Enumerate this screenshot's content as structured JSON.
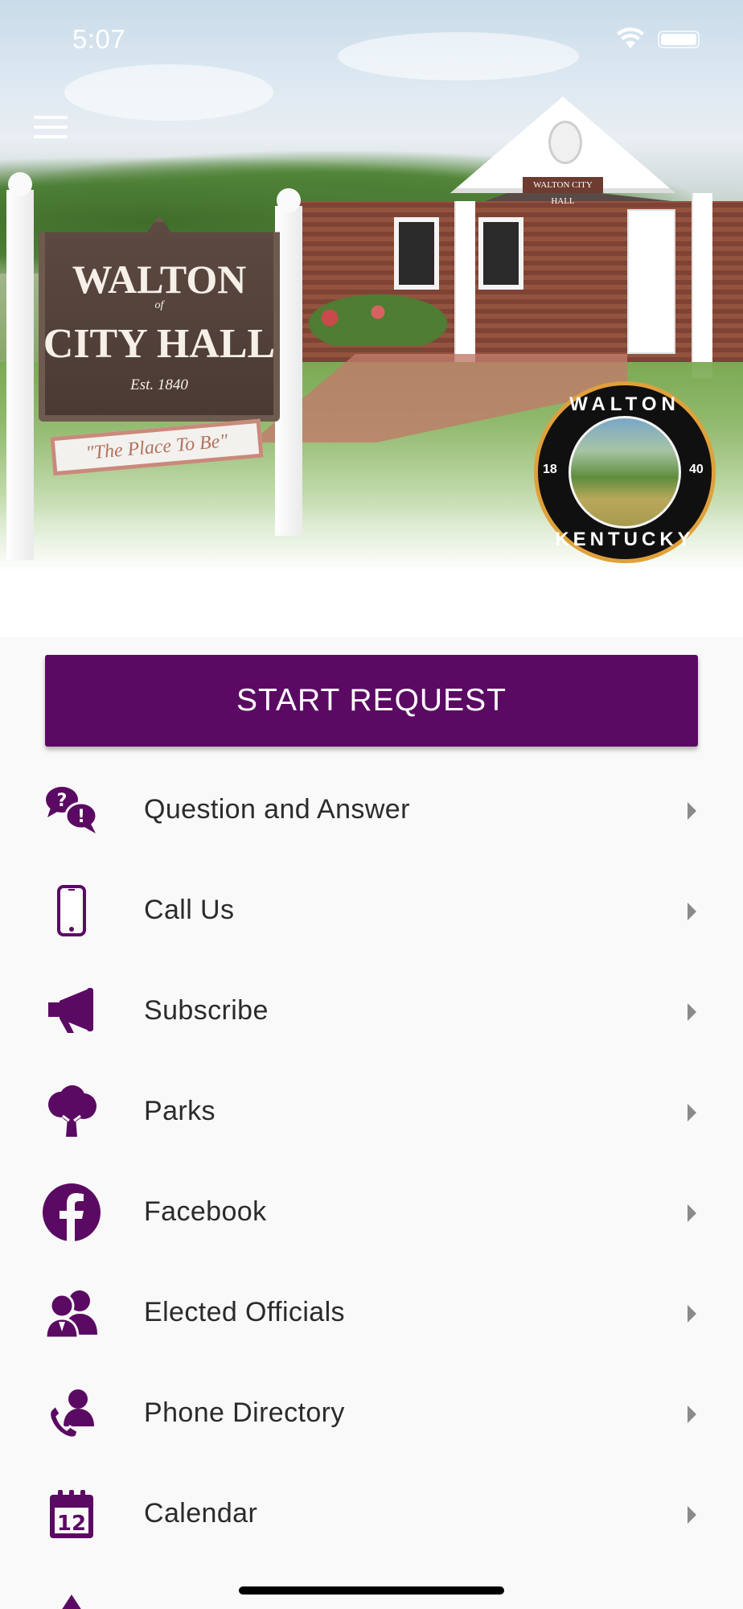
{
  "status_bar": {
    "time": "5:07"
  },
  "hero": {
    "sign_title_line1": "WALTON",
    "sign_title_small": "of",
    "sign_title_line2": "CITY HALL",
    "sign_est": "Est.   1840",
    "sign_motto": "\"The Place To Be\"",
    "building_sign": "WALTON CITY HALL"
  },
  "seal": {
    "top_text": "WALTON",
    "bottom_text": "KENTUCKY",
    "year_left": "18",
    "year_right": "40"
  },
  "start_request": {
    "label": "START REQUEST"
  },
  "menu": {
    "items": [
      {
        "label": "Question and Answer",
        "icon": "question-answer-icon"
      },
      {
        "label": "Call Us",
        "icon": "mobile-phone-icon"
      },
      {
        "label": "Subscribe",
        "icon": "megaphone-icon"
      },
      {
        "label": "Parks",
        "icon": "tree-icon"
      },
      {
        "label": "Facebook",
        "icon": "facebook-icon"
      },
      {
        "label": "Elected Officials",
        "icon": "officials-icon"
      },
      {
        "label": "Phone Directory",
        "icon": "phone-contact-icon"
      },
      {
        "label": "Calendar",
        "icon": "calendar-icon"
      }
    ]
  },
  "calendar_icon_day": "12",
  "colors": {
    "brand": "#5b0a63",
    "background": "#f9f9f9",
    "text": "#2b2b2b",
    "arrow": "#8a8a8a"
  }
}
